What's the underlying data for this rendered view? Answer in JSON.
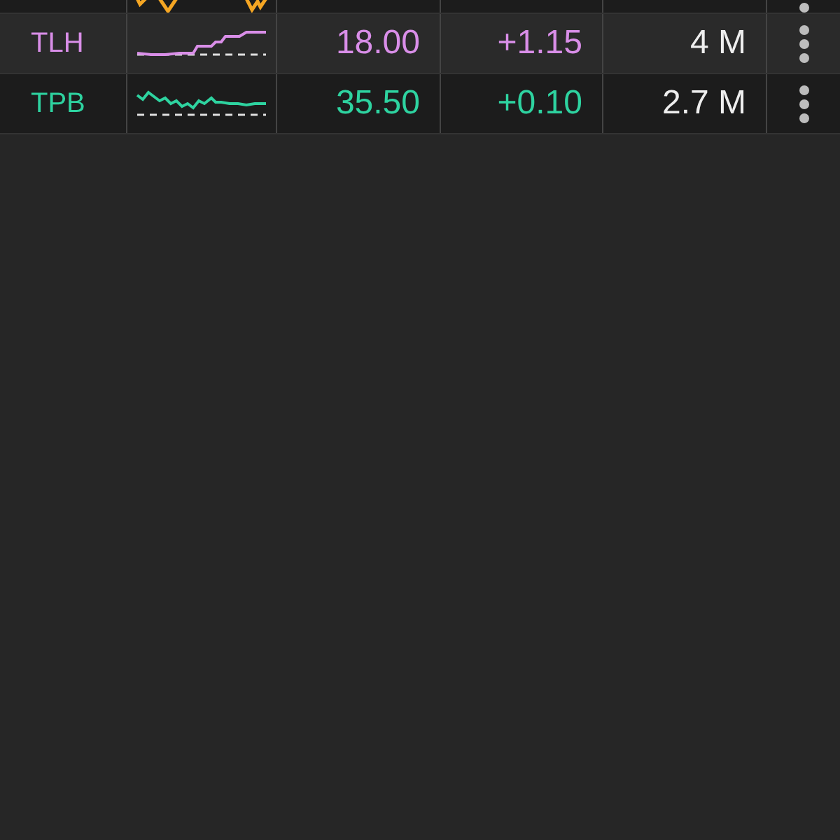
{
  "rows": [
    {
      "kind": "clipped",
      "color": "#f5a623"
    },
    {
      "kind": "full",
      "ticker": "TLH",
      "color": "#d98ee8",
      "price": "18.00",
      "change": "+1.15",
      "volume": "4 M"
    },
    {
      "kind": "full",
      "ticker": "TPB",
      "color": "#2ed3a0",
      "price": "35.50",
      "change": "+0.10",
      "volume": "2.7 M"
    }
  ]
}
